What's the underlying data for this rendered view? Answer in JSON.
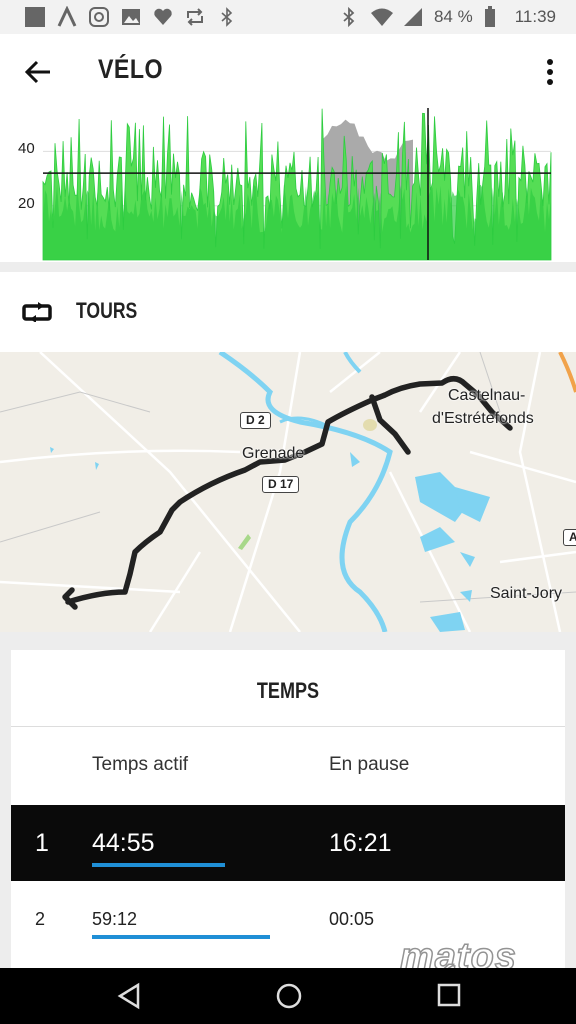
{
  "status": {
    "battery": "84 %",
    "time": "11:39"
  },
  "appbar": {
    "title": "VÉLO"
  },
  "chart_data": {
    "type": "area",
    "ytick_labels": [
      "40",
      "20"
    ],
    "yticks": [
      40,
      20
    ],
    "ylim": [
      0,
      56
    ],
    "reference_line": 32,
    "series_colors": [
      "#2ecc40",
      "#55dd55",
      "#aaaaaa"
    ],
    "grid": true
  },
  "tours": {
    "label": "TOURS"
  },
  "map": {
    "towns": [
      {
        "name": "Grenade"
      },
      {
        "name": "Castelnau-"
      },
      {
        "name": "d'Estrétefonds"
      },
      {
        "name": "Saint-Jory"
      }
    ],
    "roads": [
      "D 2",
      "D 17",
      "A"
    ]
  },
  "temps": {
    "title": "TEMPS",
    "col_active": "Temps actif",
    "col_pause": "En pause",
    "rows": [
      {
        "n": "1",
        "active": "44:55",
        "pause": "16:21",
        "progress": 0.74
      },
      {
        "n": "2",
        "active": "59:12",
        "pause": "00:05",
        "progress": 0.99
      }
    ]
  },
  "watermark": "matos VÉLO",
  "colors": {
    "green": "#2ecc40",
    "blue_bar": "#1f8fd6",
    "water": "#7fd3f2",
    "route": "#222222"
  }
}
